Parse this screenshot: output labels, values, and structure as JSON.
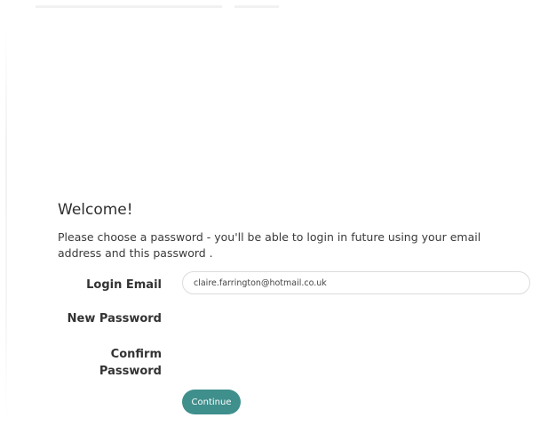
{
  "heading": "Welcome!",
  "intro": "Please choose a password - you'll be able to login in future using your email address and this password .",
  "form": {
    "email_label": "Login Email",
    "email_value": "claire.farrington@hotmail.co.uk",
    "new_password_label": "New Password",
    "confirm_password_label": "Confirm Password",
    "continue_label": "Continue"
  },
  "colors": {
    "accent": "#3f8f8c",
    "text": "#333333",
    "input_border": "#dcdcdc"
  }
}
